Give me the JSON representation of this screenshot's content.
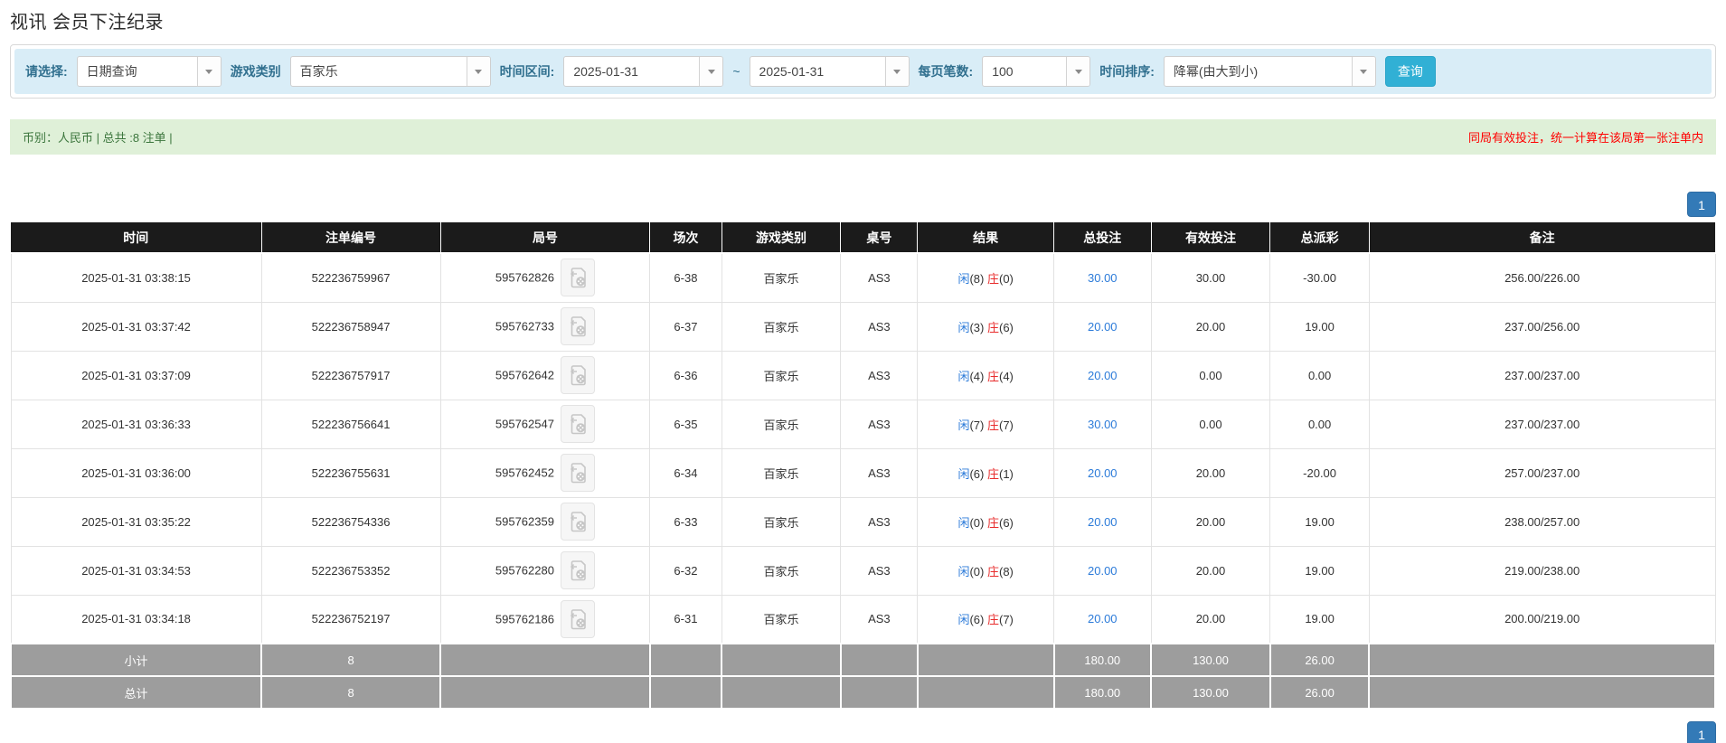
{
  "page": {
    "title": "视讯 会员下注纪录"
  },
  "filters": {
    "select_label": "请选择:",
    "select_value": "日期查询",
    "game_type_label": "游戏类别",
    "game_type_value": "百家乐",
    "time_range_label": "时间区间:",
    "date_from": "2025-01-31",
    "tilde": "~",
    "date_to": "2025-01-31",
    "page_size_label": "每页笔数:",
    "page_size_value": "100",
    "sort_label": "时间排序:",
    "sort_value": "降幂(由大到小)",
    "search_button": "查询"
  },
  "summary": {
    "left": "币别：人民币 | 总共 :8 注单 |",
    "right": "同局有效投注，统一计算在该局第一张注单内"
  },
  "pagination": {
    "page": "1"
  },
  "table": {
    "headers": [
      "时间",
      "注单编号",
      "局号",
      "场次",
      "游戏类别",
      "桌号",
      "结果",
      "总投注",
      "有效投注",
      "总派彩",
      "备注"
    ],
    "rows": [
      {
        "time": "2025-01-31 03:38:15",
        "bet_id": "522236759967",
        "round_id": "595762826",
        "session": "6-38",
        "game": "百家乐",
        "table_no": "AS3",
        "player_name": "闲",
        "player_score": "(8)",
        "banker_name": "庄",
        "banker_score": "(0)",
        "total_bet": "30.00",
        "valid_bet": "30.00",
        "payout": "-30.00",
        "note": "256.00/226.00"
      },
      {
        "time": "2025-01-31 03:37:42",
        "bet_id": "522236758947",
        "round_id": "595762733",
        "session": "6-37",
        "game": "百家乐",
        "table_no": "AS3",
        "player_name": "闲",
        "player_score": "(3)",
        "banker_name": "庄",
        "banker_score": "(6)",
        "total_bet": "20.00",
        "valid_bet": "20.00",
        "payout": "19.00",
        "note": "237.00/256.00"
      },
      {
        "time": "2025-01-31 03:37:09",
        "bet_id": "522236757917",
        "round_id": "595762642",
        "session": "6-36",
        "game": "百家乐",
        "table_no": "AS3",
        "player_name": "闲",
        "player_score": "(4)",
        "banker_name": "庄",
        "banker_score": "(4)",
        "total_bet": "20.00",
        "valid_bet": "0.00",
        "payout": "0.00",
        "note": "237.00/237.00"
      },
      {
        "time": "2025-01-31 03:36:33",
        "bet_id": "522236756641",
        "round_id": "595762547",
        "session": "6-35",
        "game": "百家乐",
        "table_no": "AS3",
        "player_name": "闲",
        "player_score": "(7)",
        "banker_name": "庄",
        "banker_score": "(7)",
        "total_bet": "30.00",
        "valid_bet": "0.00",
        "payout": "0.00",
        "note": "237.00/237.00"
      },
      {
        "time": "2025-01-31 03:36:00",
        "bet_id": "522236755631",
        "round_id": "595762452",
        "session": "6-34",
        "game": "百家乐",
        "table_no": "AS3",
        "player_name": "闲",
        "player_score": "(6)",
        "banker_name": "庄",
        "banker_score": "(1)",
        "total_bet": "20.00",
        "valid_bet": "20.00",
        "payout": "-20.00",
        "note": "257.00/237.00"
      },
      {
        "time": "2025-01-31 03:35:22",
        "bet_id": "522236754336",
        "round_id": "595762359",
        "session": "6-33",
        "game": "百家乐",
        "table_no": "AS3",
        "player_name": "闲",
        "player_score": "(0)",
        "banker_name": "庄",
        "banker_score": "(6)",
        "total_bet": "20.00",
        "valid_bet": "20.00",
        "payout": "19.00",
        "note": "238.00/257.00"
      },
      {
        "time": "2025-01-31 03:34:53",
        "bet_id": "522236753352",
        "round_id": "595762280",
        "session": "6-32",
        "game": "百家乐",
        "table_no": "AS3",
        "player_name": "闲",
        "player_score": "(0)",
        "banker_name": "庄",
        "banker_score": "(8)",
        "total_bet": "20.00",
        "valid_bet": "20.00",
        "payout": "19.00",
        "note": "219.00/238.00"
      },
      {
        "time": "2025-01-31 03:34:18",
        "bet_id": "522236752197",
        "round_id": "595762186",
        "session": "6-31",
        "game": "百家乐",
        "table_no": "AS3",
        "player_name": "闲",
        "player_score": "(6)",
        "banker_name": "庄",
        "banker_score": "(7)",
        "total_bet": "20.00",
        "valid_bet": "20.00",
        "payout": "19.00",
        "note": "200.00/219.00"
      }
    ],
    "subtotal": {
      "label": "小计",
      "count": "8",
      "total_bet": "180.00",
      "valid_bet": "130.00",
      "payout": "26.00"
    },
    "total": {
      "label": "总计",
      "count": "8",
      "total_bet": "180.00",
      "valid_bet": "130.00",
      "payout": "26.00"
    }
  }
}
